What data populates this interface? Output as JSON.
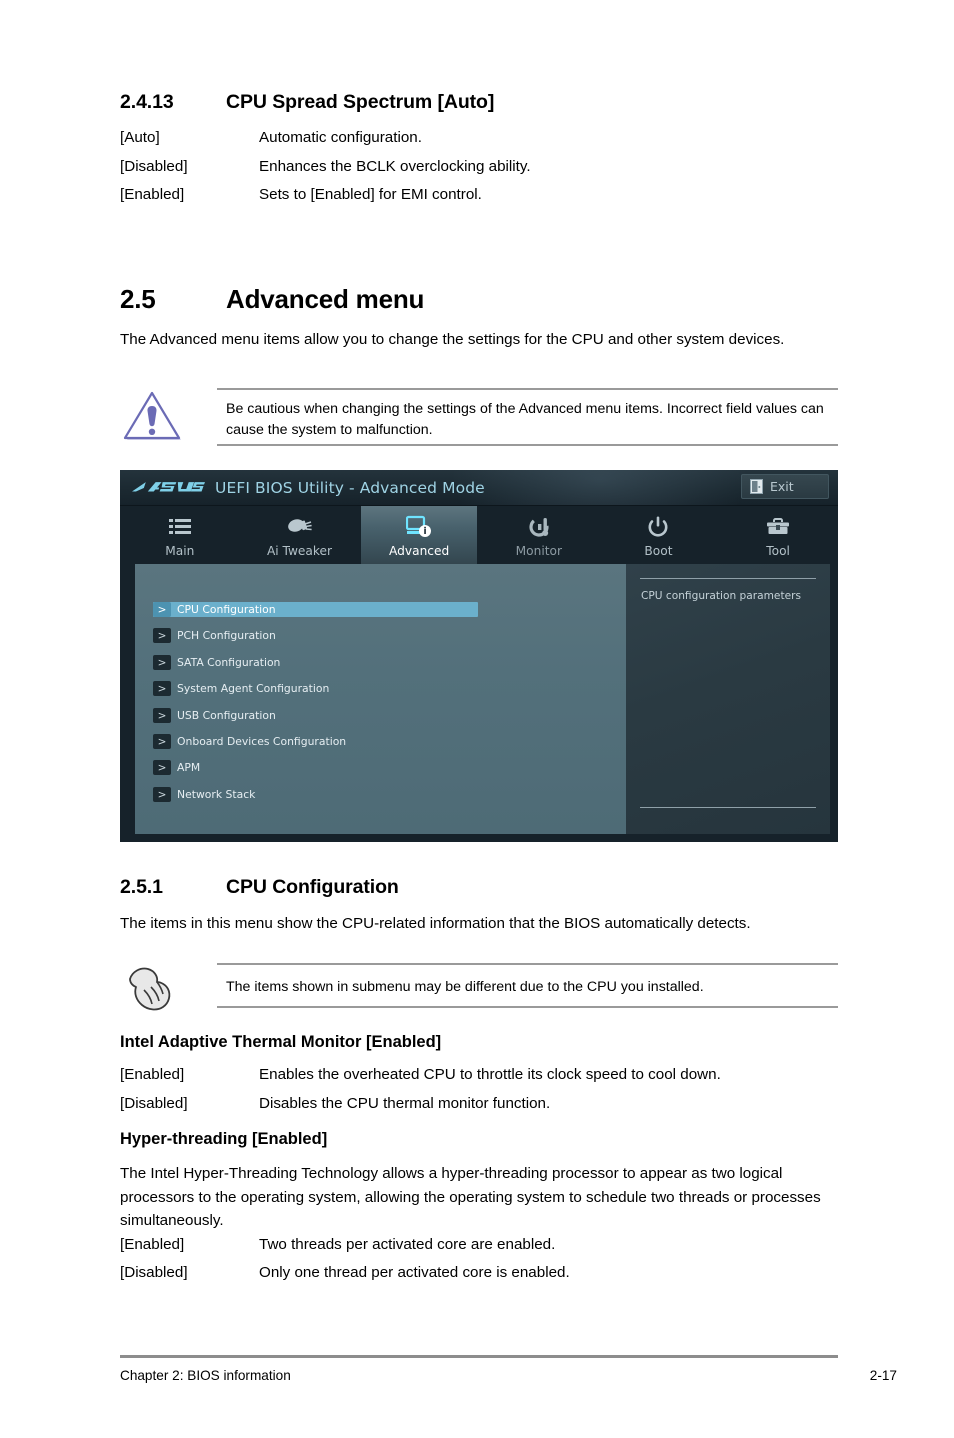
{
  "document": {
    "section_2413": {
      "number": "2.4.13",
      "title": "CPU Spread Spectrum [Auto]",
      "options": [
        {
          "key": "[Auto]",
          "desc": "Automatic configuration."
        },
        {
          "key": "[Disabled]",
          "desc": "Enhances the BCLK overclocking ability."
        },
        {
          "key": "[Enabled]",
          "desc": "Sets to [Enabled] for EMI control."
        }
      ]
    },
    "section_25": {
      "number": "2.5",
      "title": "Advanced menu",
      "intro": "The Advanced menu items allow you to change the settings for the CPU and other system devices.",
      "warning": "Be cautious when changing the settings of the Advanced menu items. Incorrect field values can cause the system to malfunction."
    },
    "section_251": {
      "number": "2.5.1",
      "title": "CPU Configuration",
      "intro": "The items in this menu show the CPU-related information that the BIOS automatically detects.",
      "note": "The items shown in submenu may be different due to the CPU you installed."
    },
    "thermal_monitor": {
      "heading": "Intel Adaptive Thermal Monitor [Enabled]",
      "options": [
        {
          "key": "[Enabled]",
          "desc": "Enables the overheated CPU to throttle its clock speed to cool down."
        },
        {
          "key": "[Disabled]",
          "desc": "Disables the CPU thermal monitor function."
        }
      ]
    },
    "hyper_threading": {
      "heading": "Hyper-threading [Enabled]",
      "body": "The Intel Hyper-Threading Technology allows a hyper-threading processor to appear as two logical processors to the operating system, allowing the operating system to schedule two threads or processes simultaneously.",
      "options": [
        {
          "key": "[Enabled]",
          "desc": "Two threads per activated core are enabled."
        },
        {
          "key": "[Disabled]",
          "desc": "Only one thread per activated core is enabled."
        }
      ]
    },
    "footer": {
      "left": "Chapter 2: BIOS information",
      "page": "2-17"
    }
  },
  "bios": {
    "logo": "asus-logo",
    "title": "UEFI BIOS Utility - Advanced Mode",
    "exit": {
      "label": "Exit",
      "icon": "exit-door-icon"
    },
    "tabs": [
      {
        "label": "Main",
        "icon": "list-icon",
        "active": false
      },
      {
        "label": "Ai  Tweaker",
        "icon": "tuner-knob-icon",
        "active": false
      },
      {
        "label": "Advanced",
        "icon": "monitor-info-icon",
        "active": true
      },
      {
        "label": "Monitor",
        "icon": "thermometer-gauge-icon",
        "active": false
      },
      {
        "label": "Boot",
        "icon": "power-icon",
        "active": false
      },
      {
        "label": "Tool",
        "icon": "toolbox-icon",
        "active": false
      }
    ],
    "menu_items": [
      {
        "arrow": ">",
        "label": "CPU Configuration",
        "selected": true
      },
      {
        "arrow": ">",
        "label": "PCH Configuration",
        "selected": false
      },
      {
        "arrow": ">",
        "label": "SATA Configuration",
        "selected": false
      },
      {
        "arrow": ">",
        "label": "System Agent Configuration",
        "selected": false
      },
      {
        "arrow": ">",
        "label": "USB Configuration",
        "selected": false
      },
      {
        "arrow": ">",
        "label": "Onboard Devices Configuration",
        "selected": false
      },
      {
        "arrow": ">",
        "label": "APM",
        "selected": false
      },
      {
        "arrow": ">",
        "label": "Network Stack",
        "selected": false
      }
    ],
    "help_panel": {
      "text": "CPU configuration parameters"
    },
    "colors": {
      "selection": "#6bb0cc",
      "left_panel": "#53707b",
      "right_panel": "#2a3a42",
      "title_text": "#9fd3e4",
      "chrome": "#16222a"
    }
  }
}
